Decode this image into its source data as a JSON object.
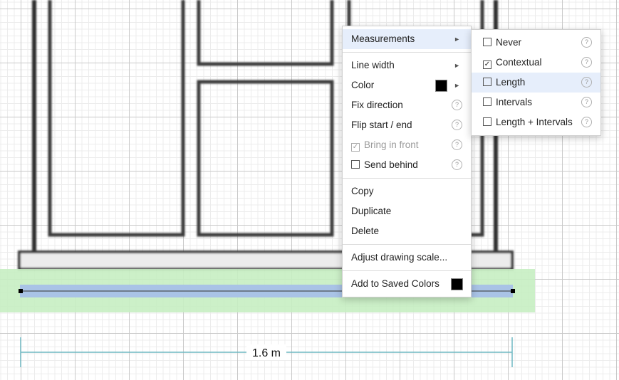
{
  "colors": {
    "wall_dark": "#2f2f2f",
    "selection_fill": "#a9c3e6",
    "selection_band": "#c7eec2",
    "dimension_line": "#6fb8c2",
    "swatch": "#000000"
  },
  "dimension": {
    "label": "1.6 m"
  },
  "context_menu": {
    "measurements": "Measurements",
    "line_width": "Line width",
    "color": "Color",
    "fix_direction": "Fix direction",
    "flip": "Flip start / end",
    "bring_in_front": "Bring in front",
    "send_behind": "Send behind",
    "copy": "Copy",
    "duplicate": "Duplicate",
    "delete": "Delete",
    "adjust_scale": "Adjust drawing scale...",
    "add_saved_colors": "Add to Saved Colors",
    "bring_in_front_checked": true,
    "send_behind_checked": false
  },
  "measurements_submenu": {
    "items": [
      {
        "label": "Never",
        "checked": false
      },
      {
        "label": "Contextual",
        "checked": true
      },
      {
        "label": "Length",
        "checked": false
      },
      {
        "label": "Intervals",
        "checked": false
      },
      {
        "label": "Length + Intervals",
        "checked": false
      }
    ],
    "highlighted_index": 2
  },
  "glyphs": {
    "arrow": "►",
    "help": "?",
    "check": "✓"
  }
}
